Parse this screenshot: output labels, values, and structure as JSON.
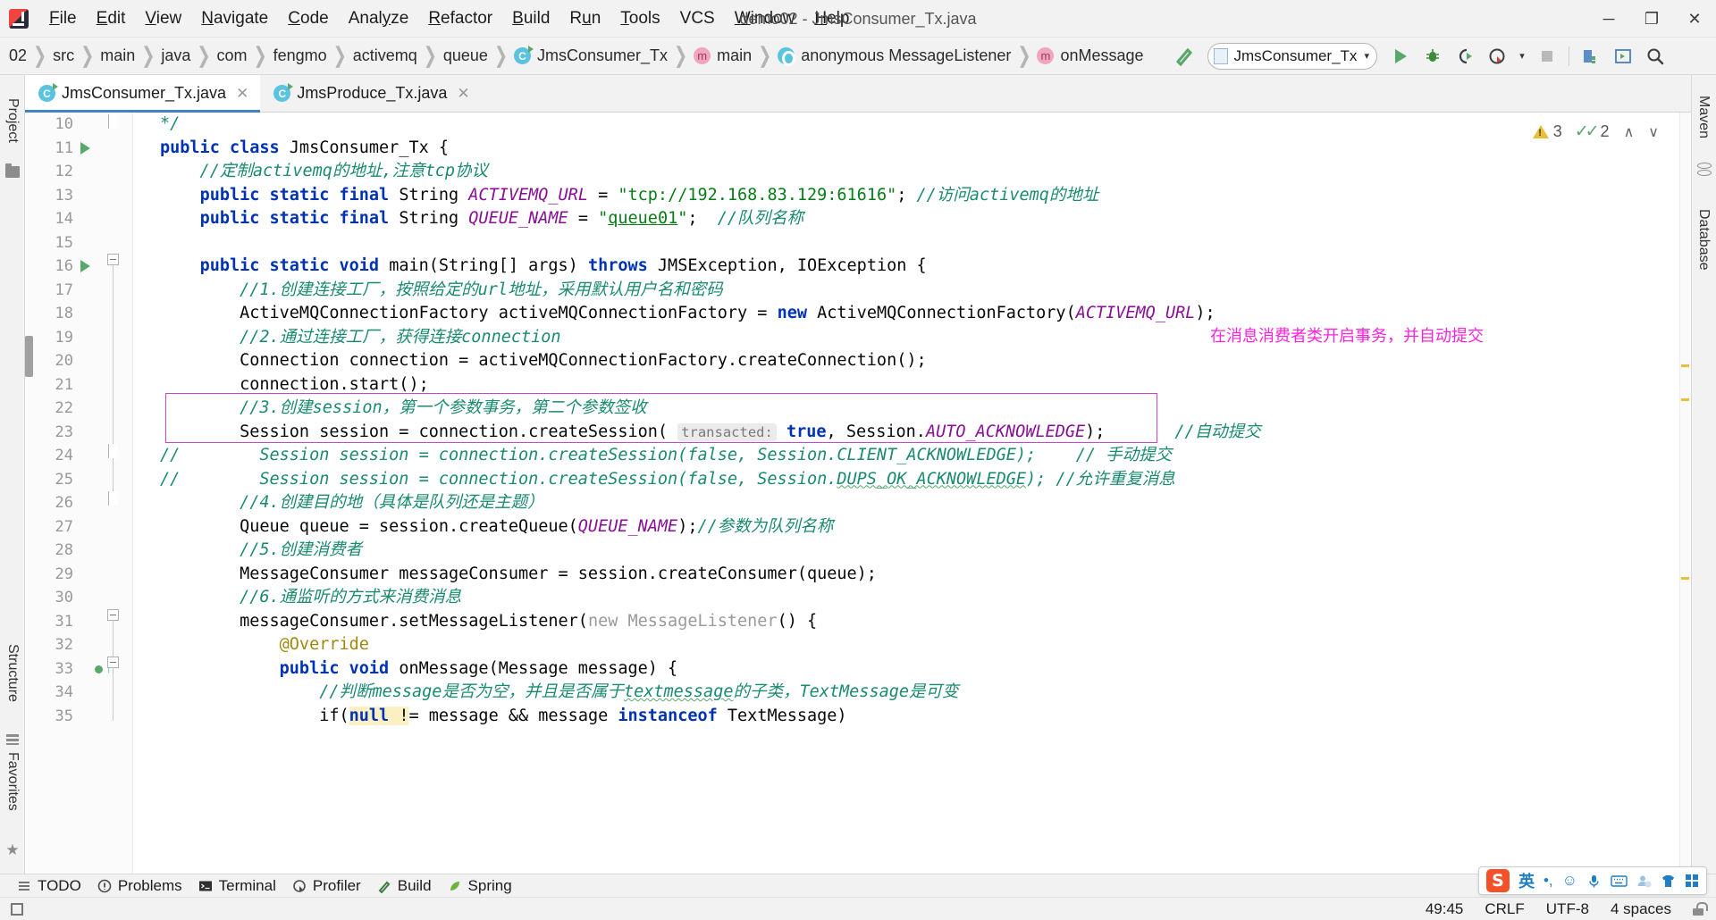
{
  "window": {
    "title": "demo02 - JmsConsumer_Tx.java",
    "minimize": "─",
    "maximize": "❐",
    "close": "✕"
  },
  "menu": [
    {
      "label": "File",
      "mnemonic": "F"
    },
    {
      "label": "Edit",
      "mnemonic": "E"
    },
    {
      "label": "View",
      "mnemonic": "V"
    },
    {
      "label": "Navigate",
      "mnemonic": "N"
    },
    {
      "label": "Code",
      "mnemonic": "C"
    },
    {
      "label": "Analyze",
      "mnemonic": "y"
    },
    {
      "label": "Refactor",
      "mnemonic": "R"
    },
    {
      "label": "Build",
      "mnemonic": "B"
    },
    {
      "label": "Run",
      "mnemonic": "u"
    },
    {
      "label": "Tools",
      "mnemonic": "T"
    },
    {
      "label": "VCS",
      "mnemonic": ""
    },
    {
      "label": "Window",
      "mnemonic": "W"
    },
    {
      "label": "Help",
      "mnemonic": "H"
    }
  ],
  "breadcrumbs": [
    {
      "label": "02",
      "icon": "none"
    },
    {
      "label": "src",
      "icon": "none"
    },
    {
      "label": "main",
      "icon": "none"
    },
    {
      "label": "java",
      "icon": "none"
    },
    {
      "label": "com",
      "icon": "none"
    },
    {
      "label": "fengmo",
      "icon": "none"
    },
    {
      "label": "activemq",
      "icon": "none"
    },
    {
      "label": "queue",
      "icon": "none"
    },
    {
      "label": "JmsConsumer_Tx",
      "icon": "class"
    },
    {
      "label": "main",
      "icon": "method"
    },
    {
      "label": "anonymous MessageListener",
      "icon": "anonymous"
    },
    {
      "label": "onMessage",
      "icon": "method"
    }
  ],
  "toolbar": {
    "build_label": "build-hammer-icon",
    "run_config": "JmsConsumer_Tx",
    "run_config_caret": "▾",
    "buttons": [
      "run-button",
      "debug-button",
      "run-coverage-button",
      "profiler-button",
      "profiler-dropdown",
      "stop-button",
      "build-project-button",
      "select-opened-file-button",
      "search-everywhere-button"
    ]
  },
  "editor_tabs": [
    {
      "label": "JmsConsumer_Tx.java",
      "active": true,
      "close": "✕"
    },
    {
      "label": "JmsProduce_Tx.java",
      "active": false,
      "close": "✕"
    }
  ],
  "left_tool_window": {
    "project": "Project",
    "structure": "Structure",
    "favorites": "Favorites"
  },
  "right_tool_window": {
    "maven": "Maven",
    "database": "Database"
  },
  "inspections": {
    "warning_count": "3",
    "ok_count": "2",
    "prev": "∧",
    "next": "∨"
  },
  "code": {
    "first_line_number": 10,
    "lines": [
      {
        "n": 10,
        "indent": 0,
        "fold": "end"
      },
      {
        "n": 11,
        "indent": 0,
        "run": true,
        "fold": "none"
      },
      {
        "n": 12,
        "indent": 0
      },
      {
        "n": 13,
        "indent": 0
      },
      {
        "n": 14,
        "indent": 0
      },
      {
        "n": 15,
        "indent": 0
      },
      {
        "n": 16,
        "indent": 0,
        "run": true
      },
      {
        "n": 17,
        "indent": 0
      },
      {
        "n": 18,
        "indent": 0
      },
      {
        "n": 19,
        "indent": 0
      },
      {
        "n": 20,
        "indent": 0
      },
      {
        "n": 21,
        "indent": 0
      },
      {
        "n": 22,
        "indent": 0
      },
      {
        "n": 23,
        "indent": 0
      },
      {
        "n": 24,
        "indent": 0
      },
      {
        "n": 25,
        "indent": 0
      },
      {
        "n": 26,
        "indent": 0
      },
      {
        "n": 27,
        "indent": 0
      },
      {
        "n": 28,
        "indent": 0
      },
      {
        "n": 29,
        "indent": 0
      },
      {
        "n": 30,
        "indent": 0
      },
      {
        "n": 31,
        "indent": 0
      },
      {
        "n": 32,
        "indent": 0
      },
      {
        "n": 33,
        "indent": 0
      },
      {
        "n": 34,
        "indent": 0
      },
      {
        "n": 35,
        "indent": 0
      }
    ],
    "text_lines": [
      "*/",
      "public class JmsConsumer_Tx {",
      "    //定制activemq的地址,注意tcp协议",
      "    public static final String ACTIVEMQ_URL = \"tcp://192.168.83.129:61616\"; //访问activemq的地址",
      "    public static final String QUEUE_NAME = \"queue01\";  //队列名称",
      "",
      "    public static void main(String[] args) throws JMSException, IOException {",
      "        //1.创建连接工厂，按照给定的url地址，采用默认用户名和密码",
      "        ActiveMQConnectionFactory activeMQConnectionFactory = new ActiveMQConnectionFactory(ACTIVEMQ_URL);",
      "        //2.通过连接工厂，获得连接connection",
      "        Connection connection = activeMQConnectionFactory.createConnection();",
      "        connection.start();",
      "        //3.创建session，第一个参数事务，第二个参数签收",
      "        Session session = connection.createSession( transacted: true, Session.AUTO_ACKNOWLEDGE);       //自动提交",
      "//        Session session = connection.createSession(false, Session.CLIENT_ACKNOWLEDGE);    // 手动提交",
      "//        Session session = connection.createSession(false, Session.DUPS_OK_ACKNOWLEDGE); //允许重复消息",
      "        //4.创建目的地（具体是队列还是主题）",
      "        Queue queue = session.createQueue(QUEUE_NAME);//参数为队列名称",
      "        //5.创建消费者",
      "        MessageConsumer messageConsumer = session.createConsumer(queue);",
      "        //6.通监听的方式来消费消息",
      "        messageConsumer.setMessageListener(new MessageListener() {",
      "            @Override",
      "            public void onMessage(Message message) {",
      "                //判断message是否为空，并且是否属于textmessage的子类，TextMessage是可变",
      "                if(null != message && message instanceof TextMessage)"
    ]
  },
  "annotation": {
    "text": "在消息消费者类开启事务，并自动提交",
    "color": "#ff22dd"
  },
  "highlight_box": {
    "color": "#cc44cc"
  },
  "bottom_tools": [
    {
      "label": "TODO",
      "icon": "list-icon"
    },
    {
      "label": "Problems",
      "icon": "error-circle-icon"
    },
    {
      "label": "Terminal",
      "icon": "terminal-icon"
    },
    {
      "label": "Profiler",
      "icon": "profiler-icon"
    },
    {
      "label": "Build",
      "icon": "hammer-icon"
    },
    {
      "label": "Spring",
      "icon": "spring-leaf-icon"
    }
  ],
  "status_bar": {
    "caret": "49:45",
    "line_separator": "CRLF",
    "encoding": "UTF-8",
    "indent": "4 spaces",
    "lock": "unlocked-icon"
  },
  "ime": {
    "logo": "S",
    "mode": "英",
    "punctuation": "•,",
    "emoji": "☺",
    "voice": "🎙",
    "keyboard": "⌨",
    "account": "account-icon",
    "skin": "skin-shirt-icon",
    "menu": "grid-menu-icon"
  }
}
